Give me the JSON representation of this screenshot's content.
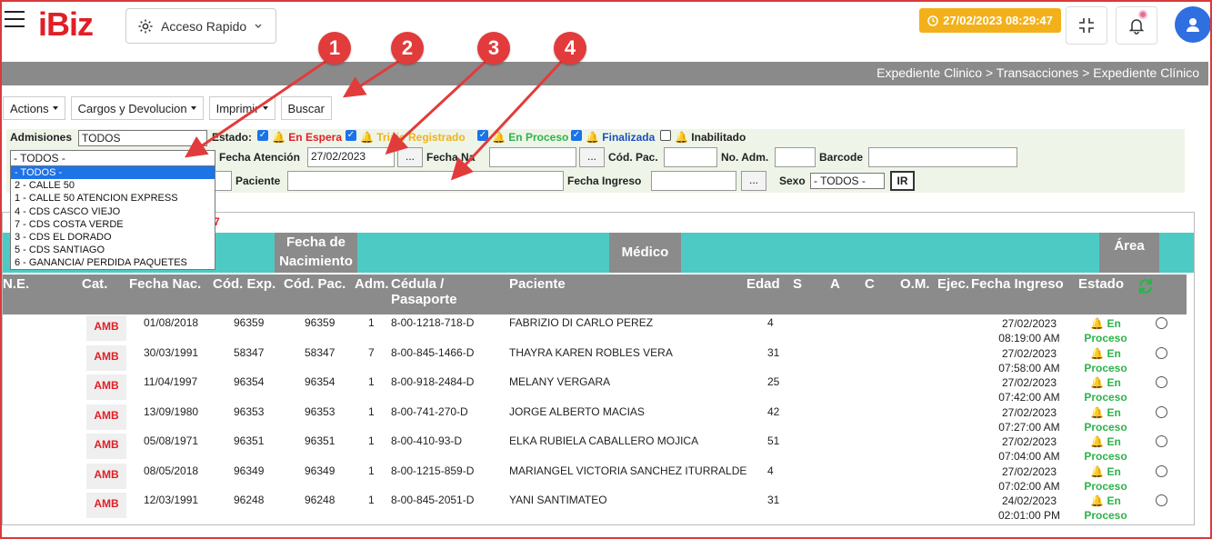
{
  "header": {
    "logo": "iBiz",
    "quick_access": "Acceso Rapido",
    "datetime": "27/02/2023 08:29:47"
  },
  "breadcrumb": "Expediente Clinico > Transacciones > Expediente Clínico",
  "toolbar": {
    "actions": "Actions",
    "cargos": "Cargos y Devolucion",
    "imprimir": "Imprimir",
    "buscar": "Buscar"
  },
  "filters": {
    "admisiones_label": "Admisiones",
    "admisiones_value": "TODOS",
    "estado_label": "Estado:",
    "en_espera": "En Espera",
    "triaje": "Triaje Registrado",
    "en_proceso": "En Proceso",
    "finalizada": "Finalizada",
    "inabilitado": "Inabilitado",
    "sede_value": "- TODOS -",
    "fecha_atencion_label": "Fecha Atención",
    "fecha_atencion_value": "27/02/2023",
    "fecha_nac_label": "Fecha Na",
    "cod_pac_label": "Cód. Pac.",
    "no_adm_label": "No. Adm.",
    "barcode_label": "Barcode",
    "paciente_label": "Paciente",
    "fecha_ingreso_label": "Fecha Ingreso",
    "sexo_label": "Sexo",
    "sexo_value": "- TODOS -",
    "ir": "IR",
    "dots": "..."
  },
  "dropdown_options": [
    "- TODOS -",
    "2 - CALLE 50",
    "1 - CALLE 50 ATENCION EXPRESS",
    "4 - CDS CASCO VIEJO",
    "7 - CDS COSTA VERDE",
    "3 - CDS EL DORADO",
    "5 - CDS SANTIAGO",
    "6 - GANANCIA/ PERDIDA PAQUETES"
  ],
  "partial_text": "7",
  "group_headers": {
    "fecha_nacimiento_1": "Fecha de",
    "fecha_nacimiento_2": "Nacimiento",
    "medico": "Médico",
    "area": "Área"
  },
  "columns": {
    "ne": "N.E.",
    "cat": "Cat.",
    "fecha_nac": "Fecha Nac.",
    "cod_exp": "Cód. Exp.",
    "cod_pac": "Cód. Pac.",
    "adm": "Adm.",
    "cedula_1": "Cédula /",
    "cedula_2": "Pasaporte",
    "paciente": "Paciente",
    "edad": "Edad",
    "s": "S",
    "a": "A",
    "c": "C",
    "om": "O.M.",
    "ejec": "Ejec.",
    "fecha_ingreso": "Fecha Ingreso",
    "estado": "Estado"
  },
  "rows": [
    {
      "cat": "AMB",
      "fecha_nac": "01/08/2018",
      "cod_exp": "96359",
      "cod_pac": "96359",
      "adm": "1",
      "cedula": "8-00-1218-718-D",
      "paciente": "FABRIZIO DI CARLO PEREZ",
      "edad": "4",
      "fecha": "27/02/2023",
      "hora": "08:19:00 AM",
      "estado_1": "En",
      "estado_2": "Proceso"
    },
    {
      "cat": "AMB",
      "fecha_nac": "30/03/1991",
      "cod_exp": "58347",
      "cod_pac": "58347",
      "adm": "7",
      "cedula": "8-00-845-1466-D",
      "paciente": "THAYRA KAREN ROBLES VERA",
      "edad": "31",
      "fecha": "27/02/2023",
      "hora": "07:58:00 AM",
      "estado_1": "En",
      "estado_2": "Proceso"
    },
    {
      "cat": "AMB",
      "fecha_nac": "11/04/1997",
      "cod_exp": "96354",
      "cod_pac": "96354",
      "adm": "1",
      "cedula": "8-00-918-2484-D",
      "paciente": "MELANY VERGARA",
      "edad": "25",
      "fecha": "27/02/2023",
      "hora": "07:42:00 AM",
      "estado_1": "En",
      "estado_2": "Proceso"
    },
    {
      "cat": "AMB",
      "fecha_nac": "13/09/1980",
      "cod_exp": "96353",
      "cod_pac": "96353",
      "adm": "1",
      "cedula": "8-00-741-270-D",
      "paciente": "JORGE ALBERTO MACIAS",
      "edad": "42",
      "fecha": "27/02/2023",
      "hora": "07:27:00 AM",
      "estado_1": "En",
      "estado_2": "Proceso"
    },
    {
      "cat": "AMB",
      "fecha_nac": "05/08/1971",
      "cod_exp": "96351",
      "cod_pac": "96351",
      "adm": "1",
      "cedula": "8-00-410-93-D",
      "paciente": "ELKA RUBIELA CABALLERO MOJICA",
      "edad": "51",
      "fecha": "27/02/2023",
      "hora": "07:04:00 AM",
      "estado_1": "En",
      "estado_2": "Proceso"
    },
    {
      "cat": "AMB",
      "fecha_nac": "08/05/2018",
      "cod_exp": "96349",
      "cod_pac": "96349",
      "adm": "1",
      "cedula": "8-00-1215-859-D",
      "paciente": "MARIANGEL VICTORIA SANCHEZ ITURRALDE",
      "edad": "4",
      "fecha": "27/02/2023",
      "hora": "07:02:00 AM",
      "estado_1": "En",
      "estado_2": "Proceso"
    },
    {
      "cat": "AMB",
      "fecha_nac": "12/03/1991",
      "cod_exp": "96248",
      "cod_pac": "96248",
      "adm": "1",
      "cedula": "8-00-845-2051-D",
      "paciente": "YANI SANTIMATEO",
      "edad": "31",
      "fecha": "24/02/2023",
      "hora": "02:01:00 PM",
      "estado_1": "En",
      "estado_2": "Proceso"
    }
  ],
  "annotations": [
    "1",
    "2",
    "3",
    "4"
  ],
  "colors": {
    "brand_red": "#e01f26",
    "teal": "#4ecac4",
    "header_gray": "#8b8b8b",
    "badge_yellow": "#f2b11b",
    "status_green": "#2db34a"
  }
}
